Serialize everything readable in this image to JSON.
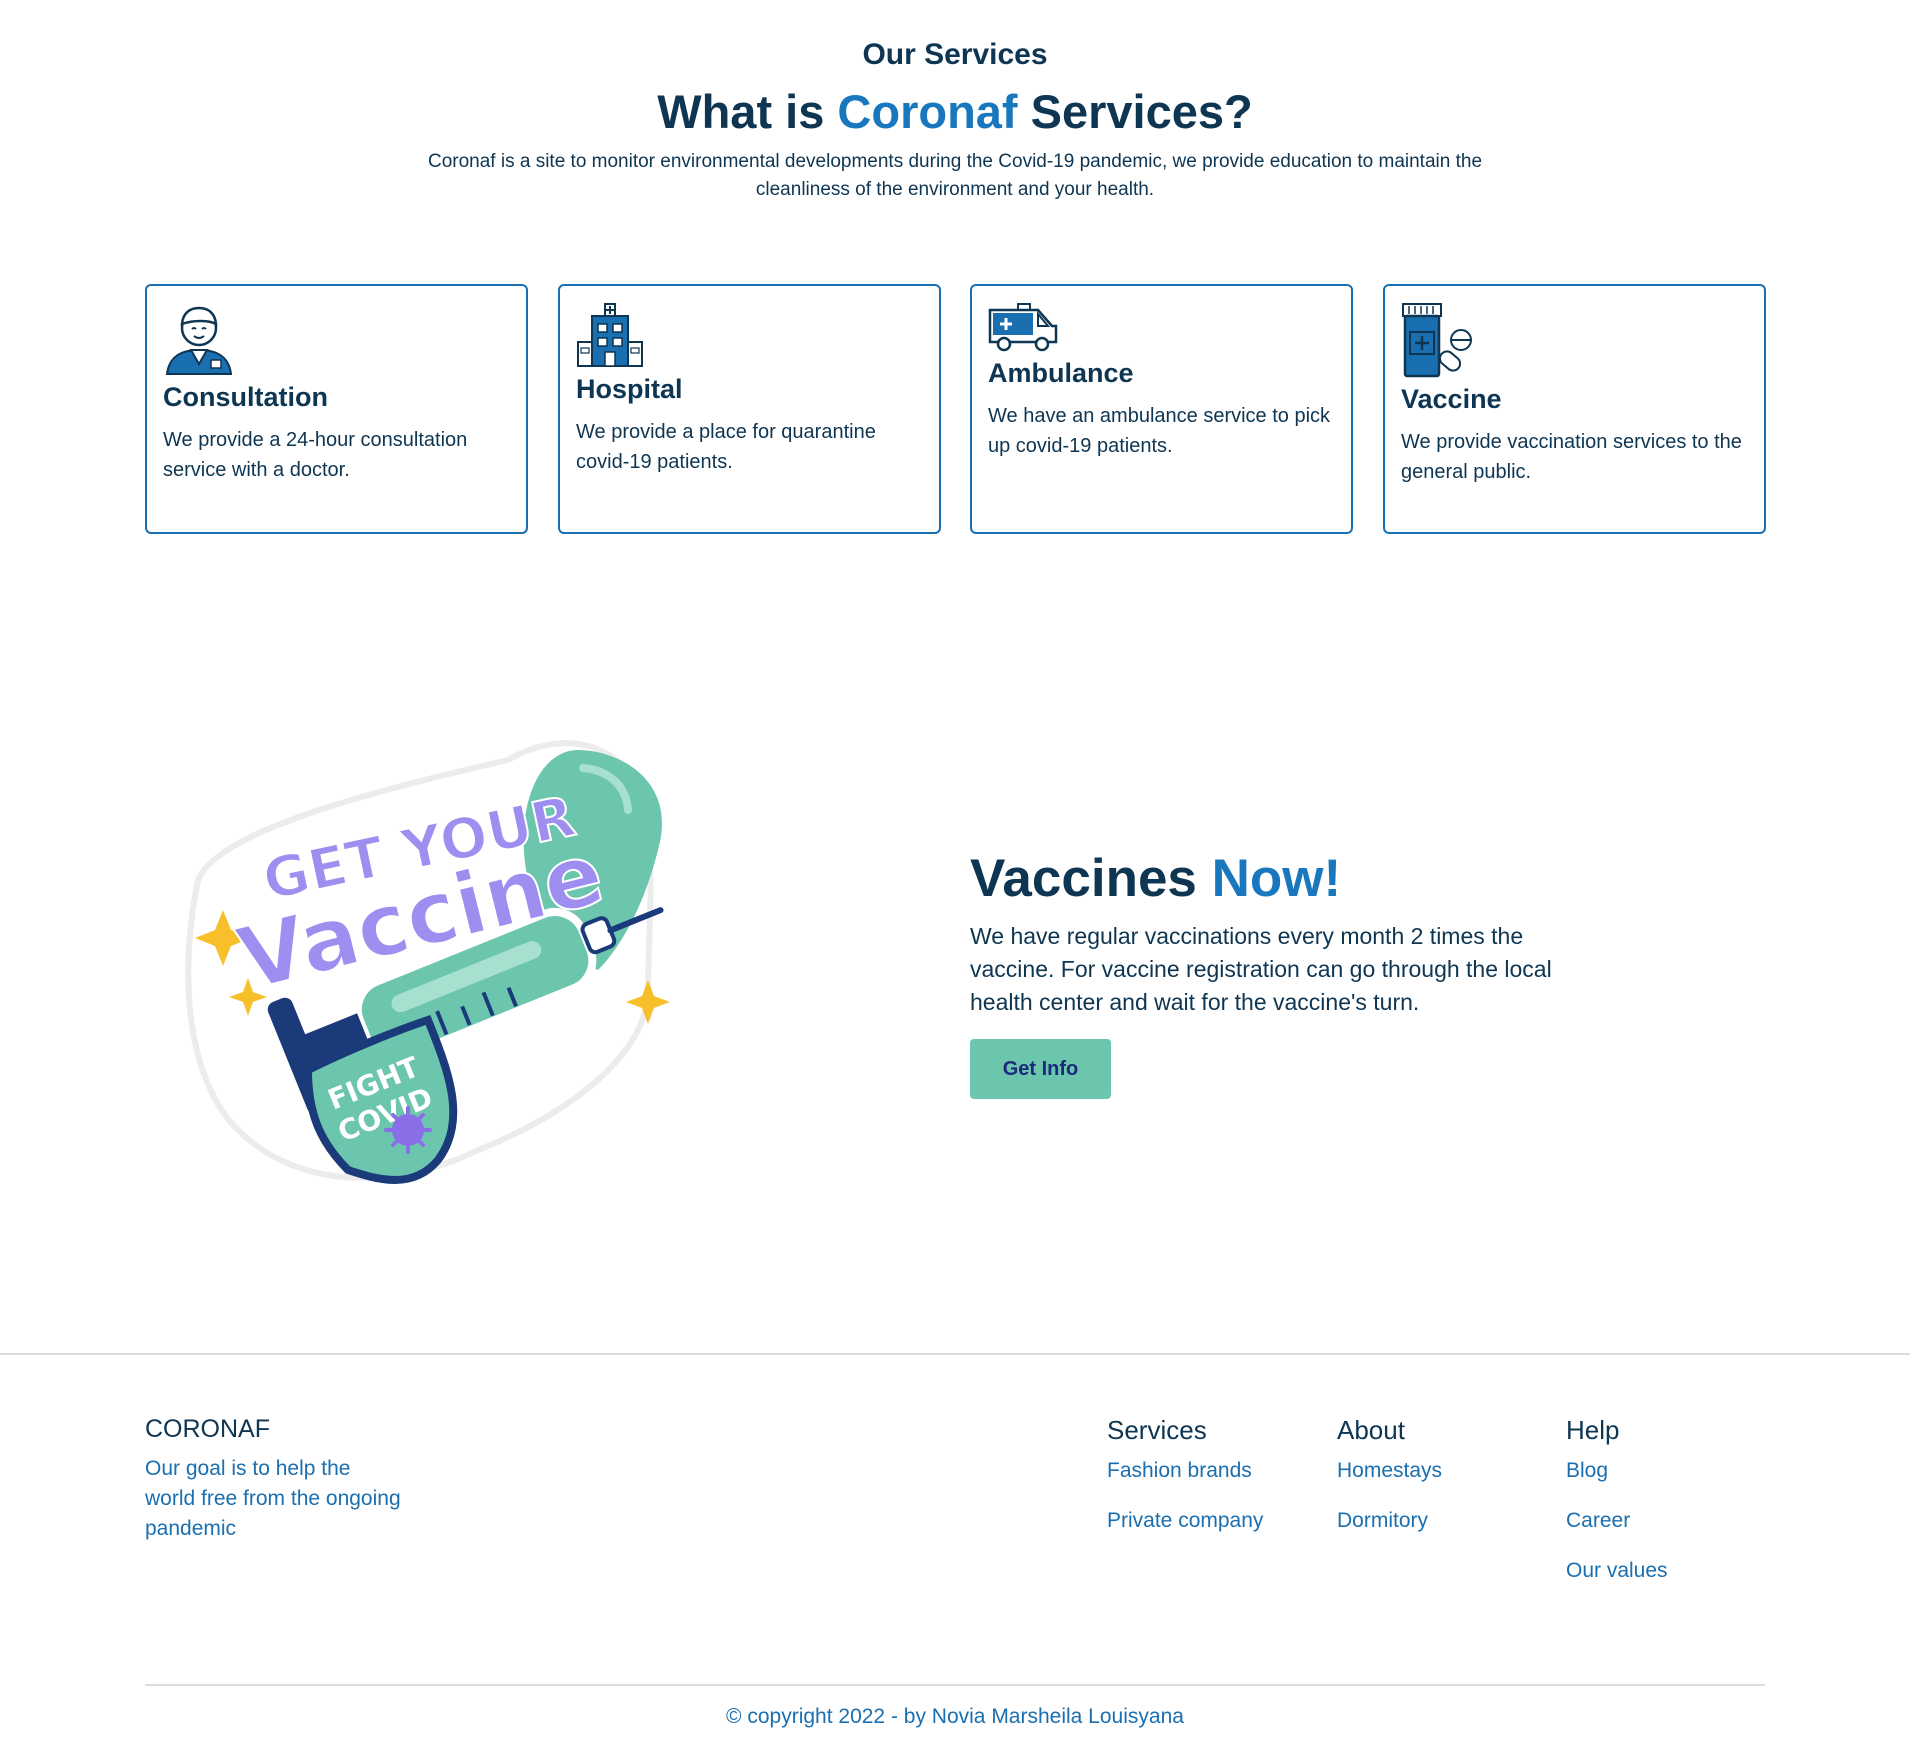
{
  "services": {
    "kicker": "Our Services",
    "title_prefix": "What is ",
    "title_accent": "Coronaf",
    "title_suffix": " Services?",
    "description": "Coronaf is a site to monitor environmental developments during the Covid-19 pandemic, we provide education to maintain the cleanliness of the environment and your health.",
    "cards": [
      {
        "icon": "doctor-icon",
        "title": "Consultation",
        "text": "We provide a 24-hour consultation service with a doctor."
      },
      {
        "icon": "hospital-icon",
        "title": "Hospital",
        "text": "We provide a place for quarantine covid-19 patients."
      },
      {
        "icon": "ambulance-icon",
        "title": "Ambulance",
        "text": "We have an ambulance service to pick up covid-19 patients."
      },
      {
        "icon": "vaccine-bottle-icon",
        "title": "Vaccine",
        "text": "We provide vaccination services to the general public."
      }
    ]
  },
  "promo": {
    "sticker_line1": "GET YOUR",
    "sticker_line2": "Vaccine",
    "badge_line1": "FIGHT",
    "badge_line2": "COVID",
    "title_prefix": "Vaccines ",
    "title_accent": "Now!",
    "text": "We have regular vaccinations every month 2 times the vaccine. For vaccine registration can go through the local health center and wait for the vaccine's turn.",
    "button_label": "Get Info"
  },
  "footer": {
    "brand": "CORONAF",
    "tagline": "Our goal is to help the world free from the ongoing pandemic",
    "columns": [
      {
        "title": "Services",
        "links": [
          "Fashion brands",
          "Private company"
        ]
      },
      {
        "title": "About",
        "links": [
          "Homestays",
          "Dormitory"
        ]
      },
      {
        "title": "Help",
        "links": [
          "Blog",
          "Career",
          "Our values"
        ]
      }
    ],
    "copyright": "© copyright 2022 - by Novia Marsheila Louisyana"
  },
  "colors": {
    "navy": "#0e3552",
    "accent_blue": "#1877bd",
    "card_border": "#1a6fb0",
    "button_green": "#6cc5ad",
    "button_text": "#1b2a7a"
  }
}
